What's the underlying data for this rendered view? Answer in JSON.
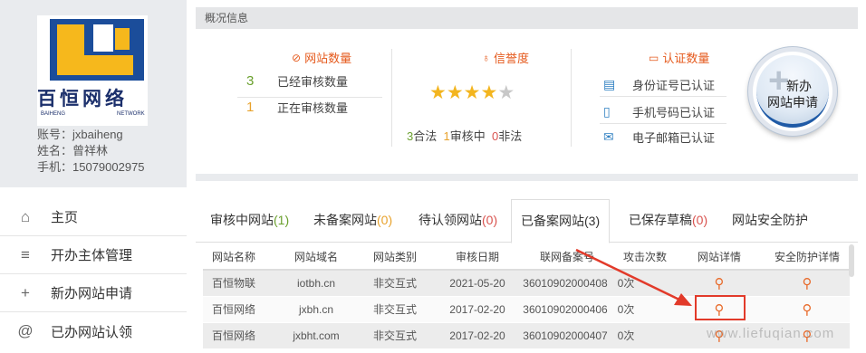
{
  "profile": {
    "logo_cn": "百恒网络",
    "logo_en_left": "BAIHENG",
    "logo_en_right": "NETWORK",
    "account": "账号：jxbaiheng",
    "name": "姓名：曾祥林",
    "phone": "手机：15079002975"
  },
  "nav": [
    {
      "icon": "home-icon",
      "label": "主页"
    },
    {
      "icon": "list-icon",
      "label": "开办主体管理"
    },
    {
      "icon": "plus-icon",
      "label": "新办网站申请"
    },
    {
      "icon": "at-icon",
      "label": "已办网站认领"
    }
  ],
  "overview": {
    "header": "概况信息",
    "site_count_title": "网站数量",
    "stats": [
      {
        "num": "3",
        "label": "已经审核数量",
        "color": "#6aa02d"
      },
      {
        "num": "1",
        "label": "正在审核数量",
        "color": "#e8a22c"
      }
    ],
    "credit_title": "信誉度",
    "rating": 4,
    "rating_max": 5,
    "credit": {
      "legal_num": "3",
      "legal_label": "合法",
      "review_num": "1",
      "review_label": "审核中",
      "illegal_num": "0",
      "illegal_label": "非法"
    },
    "cert_title": "认证数量",
    "certs": [
      {
        "icon": "id-card-icon",
        "label": "身份证号已认证"
      },
      {
        "icon": "phone-icon",
        "label": "手机号码已认证"
      },
      {
        "icon": "mail-icon",
        "label": "电子邮箱已认证"
      }
    ],
    "new_button": {
      "line1": "新办",
      "line2": "网站申请"
    }
  },
  "tabs": [
    {
      "label": "审核中网站",
      "count": "(1)",
      "cls": "cnt-g"
    },
    {
      "label": "未备案网站",
      "count": "(0)",
      "cls": "cnt-o"
    },
    {
      "label": "待认领网站",
      "count": "(0)",
      "cls": "cnt-r"
    },
    {
      "label": "已备案网站",
      "count": "(3)",
      "cls": ""
    },
    {
      "label": "已保存草稿",
      "count": "(0)",
      "cls": "cnt-r"
    },
    {
      "label": "网站安全防护",
      "count": "",
      "cls": ""
    }
  ],
  "table": {
    "headers": [
      "网站名称",
      "网站域名",
      "网站类别",
      "审核日期",
      "联网备案号",
      "攻击次数",
      "网站详情",
      "安全防护详情"
    ],
    "rows": [
      [
        "百恒物联",
        "iotbh.cn",
        "非交互式",
        "2021-05-20",
        "36010902000408",
        "0次"
      ],
      [
        "百恒网络",
        "jxbh.cn",
        "非交互式",
        "2017-02-20",
        "36010902000406",
        "0次"
      ],
      [
        "百恒网络",
        "jxbht.com",
        "非交互式",
        "2017-02-20",
        "36010902000407",
        "0次"
      ]
    ]
  },
  "watermark": "www.liefuqian.com",
  "colors": {
    "accent": "#e55a1d",
    "highlight": "#e23a2a",
    "star": "#f3b51f"
  }
}
